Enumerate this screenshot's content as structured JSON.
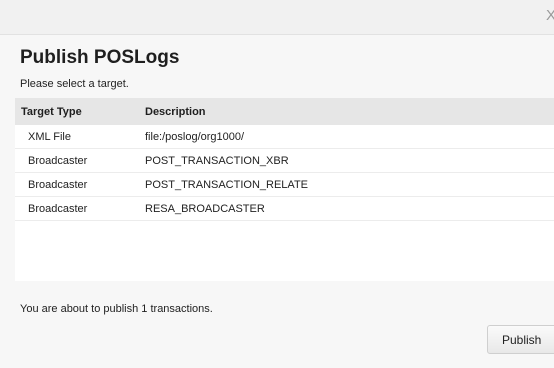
{
  "dialog": {
    "close_glyph": "X",
    "title": "Publish POSLogs",
    "prompt": "Please select a target.",
    "table": {
      "headers": [
        "Target Type",
        "Description"
      ],
      "rows": [
        [
          "XML File",
          "file:/poslog/org1000/"
        ],
        [
          "Broadcaster",
          "POST_TRANSACTION_XBR"
        ],
        [
          "Broadcaster",
          "POST_TRANSACTION_RELATE"
        ],
        [
          "Broadcaster",
          "RESA_BROADCASTER"
        ]
      ]
    },
    "message": "You are about to publish 1 transactions.",
    "publish_label": "Publish"
  }
}
